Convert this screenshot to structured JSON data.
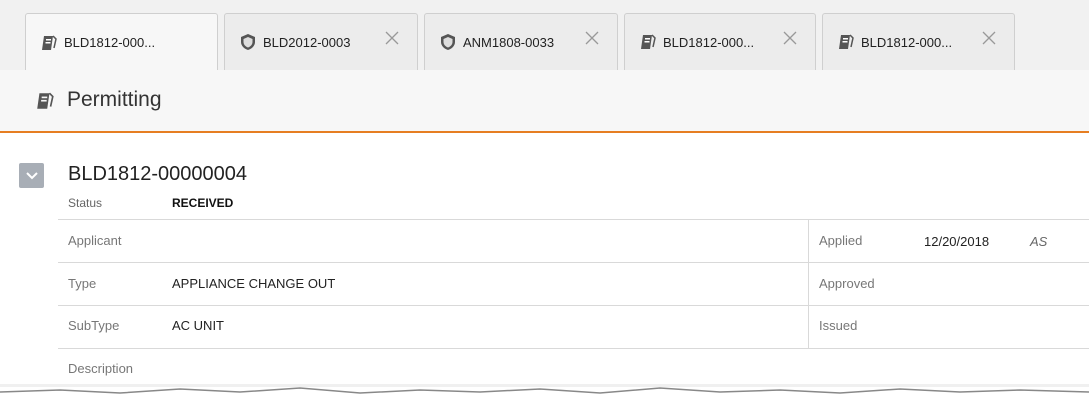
{
  "tabs": [
    {
      "label": "BLD1812-000...",
      "icon": "permit-icon",
      "closable": false,
      "active": true
    },
    {
      "label": "BLD2012-0003",
      "icon": "shield-icon",
      "closable": true,
      "active": false
    },
    {
      "label": "ANM1808-0033",
      "icon": "shield-icon",
      "closable": true,
      "active": false
    },
    {
      "label": "BLD1812-000...",
      "icon": "permit-icon",
      "closable": true,
      "active": false
    },
    {
      "label": "BLD1812-000...",
      "icon": "permit-icon",
      "closable": true,
      "active": false
    }
  ],
  "header": {
    "title": "Permitting",
    "icon": "permit-icon"
  },
  "record": {
    "id": "BLD1812-00000004",
    "status_label": "Status",
    "status_value": "RECEIVED"
  },
  "fields": {
    "applicant_label": "Applicant",
    "applicant_value": "",
    "type_label": "Type",
    "type_value": "APPLIANCE CHANGE OUT",
    "subtype_label": "SubType",
    "subtype_value": "AC UNIT",
    "description_label": "Description",
    "applied_label": "Applied",
    "applied_value": "12/20/2018",
    "applied_initials": "AS",
    "approved_label": "Approved",
    "issued_label": "Issued"
  },
  "colors": {
    "accent": "#e67e22",
    "collapse_button": "#a8aeb6"
  }
}
